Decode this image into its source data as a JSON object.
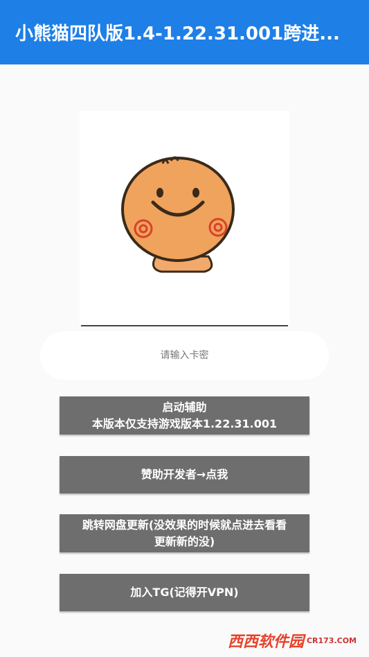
{
  "appbar": {
    "title": "小熊猫四队版1.4-1.22.31.001跨进..."
  },
  "login": {
    "placeholder": "请输入卡密"
  },
  "buttons": {
    "start": {
      "line1": "启动辅助",
      "line2": "本版本仅支持游戏版本1.22.31.001"
    },
    "sponsor": {
      "label": "赞助开发者→点我"
    },
    "update": {
      "line1": "跳转网盘更新(没效果的时候就点进去看看",
      "line2": "更新新的没)"
    },
    "telegram": {
      "label": "加入TG(记得开VPN)"
    }
  },
  "colors": {
    "appbar": "#1e7fe6",
    "button": "#6e6e6e",
    "background": "#fafafa"
  },
  "icons": {
    "avatar": "smiling-face-icon"
  },
  "watermark": {
    "text": "西西软件园",
    "sub": "CR173.COM"
  }
}
